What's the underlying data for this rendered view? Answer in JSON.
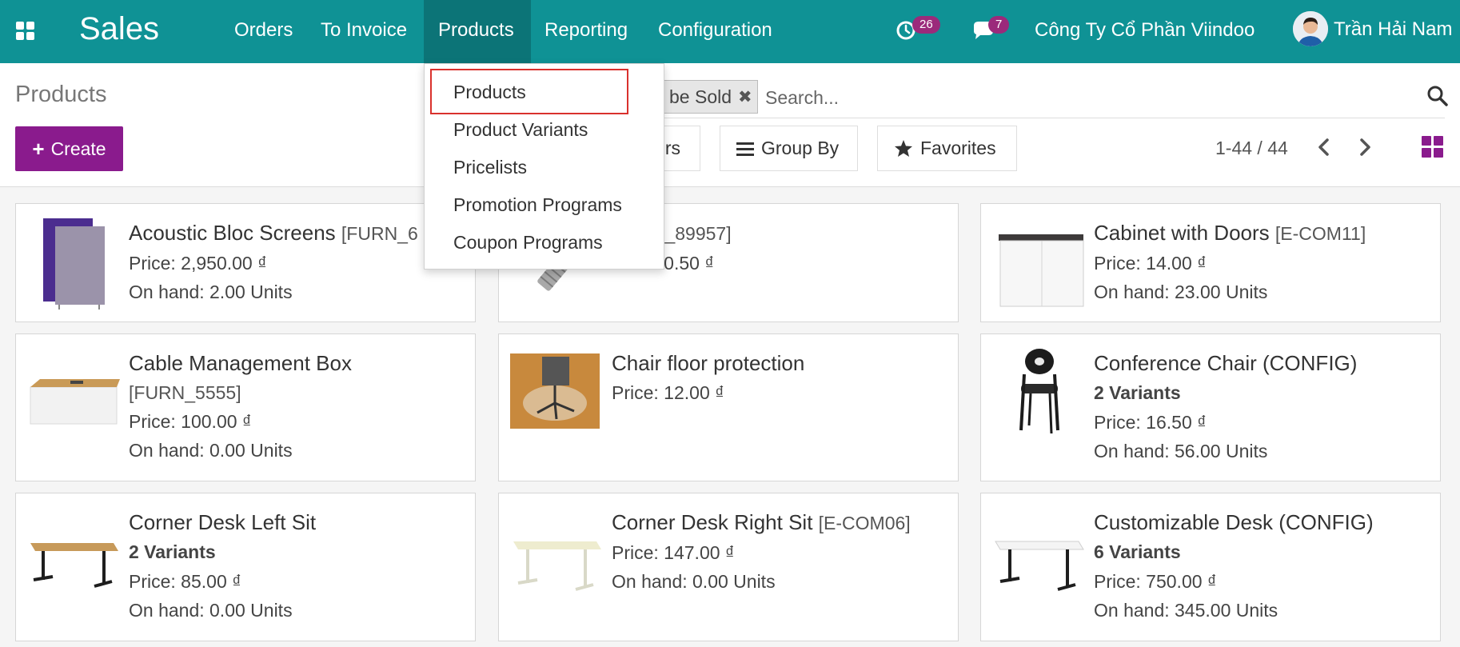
{
  "navbar": {
    "app_name": "Sales",
    "menu": [
      {
        "label": "Orders"
      },
      {
        "label": "To Invoice"
      },
      {
        "label": "Products"
      },
      {
        "label": "Reporting"
      },
      {
        "label": "Configuration"
      }
    ],
    "active_menu": "Products",
    "activity_count": "26",
    "message_count": "7",
    "company": "Công Ty Cổ Phần Viindoo",
    "user_name": "Trần Hải Nam",
    "bar_color": "#0f9295"
  },
  "products_dropdown": {
    "items": [
      {
        "label": "Products"
      },
      {
        "label": "Product Variants"
      },
      {
        "label": "Pricelists"
      },
      {
        "label": "Promotion Programs"
      },
      {
        "label": "Coupon Programs"
      }
    ],
    "highlighted": "Products"
  },
  "control_panel": {
    "breadcrumb": "Products",
    "create_label": "Create",
    "search": {
      "facet_label": "be Sold",
      "placeholder": "Search..."
    },
    "filters_label": "rs",
    "group_by_label": "Group By",
    "favorites_label": "Favorites",
    "pager": "1-44 / 44",
    "accent_color": "#8a1b8d"
  },
  "products": [
    {
      "name": "Acoustic Bloc Screens",
      "code": "[FURN_6",
      "variants": "",
      "price": "Price: 2,950.00 ₫",
      "on_hand": "On hand: 2.00 Units",
      "icon": "acoustic-screen-icon"
    },
    {
      "name": "",
      "code": "CONS_89957]",
      "variants": "",
      "price": "Price: 0.50 ₫",
      "on_hand": "",
      "icon": "bolt-icon"
    },
    {
      "name": "Cabinet with Doors",
      "code": "[E-COM11]",
      "variants": "",
      "price": "Price: 14.00 ₫",
      "on_hand": "On hand: 23.00 Units",
      "icon": "cabinet-icon"
    },
    {
      "name": "Cable Management Box",
      "code": "[FURN_5555]",
      "variants": "",
      "price": "Price: 100.00 ₫",
      "on_hand": "On hand: 0.00 Units",
      "icon": "cable-box-icon"
    },
    {
      "name": "Chair floor protection",
      "code": "",
      "variants": "",
      "price": "Price: 12.00 ₫",
      "on_hand": "",
      "icon": "chair-mat-icon"
    },
    {
      "name": "Conference Chair (CONFIG)",
      "code": "",
      "variants": "2 Variants",
      "price": "Price: 16.50 ₫",
      "on_hand": "On hand: 56.00 Units",
      "icon": "chair-icon"
    },
    {
      "name": "Corner Desk Left Sit",
      "code": "",
      "variants": "2 Variants",
      "price": "Price: 85.00 ₫",
      "on_hand": "On hand: 0.00 Units",
      "icon": "desk-icon"
    },
    {
      "name": "Corner Desk Right Sit",
      "code": "[E-COM06]",
      "variants": "",
      "price": "Price: 147.00 ₫",
      "on_hand": "On hand: 0.00 Units",
      "icon": "desk-icon"
    },
    {
      "name": "Customizable Desk (CONFIG)",
      "code": "",
      "variants": "6 Variants",
      "price": "Price: 750.00 ₫",
      "on_hand": "On hand: 345.00 Units",
      "icon": "desk-icon"
    }
  ]
}
